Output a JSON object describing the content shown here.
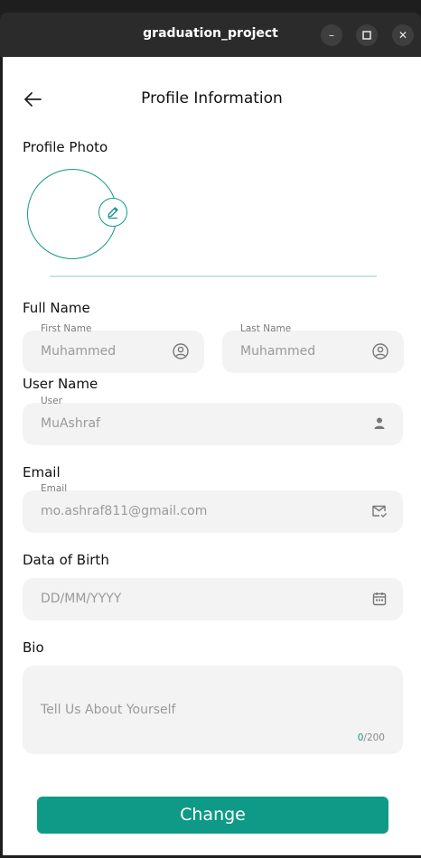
{
  "window": {
    "title": "graduation_project"
  },
  "header": {
    "title": "Profile Information"
  },
  "profile_photo": {
    "label": "Profile Photo"
  },
  "full_name": {
    "label": "Full Name",
    "first": {
      "label": "First Name",
      "placeholder": "Muhammed"
    },
    "last": {
      "label": "Last Name",
      "placeholder": "Muhammed"
    }
  },
  "user_name": {
    "label": "User Name",
    "field_label": "User",
    "placeholder": "MuAshraf"
  },
  "email": {
    "label": "Email",
    "field_label": "Email",
    "placeholder": "mo.ashraf811@gmail.com"
  },
  "dob": {
    "label": "Data of Birth",
    "placeholder": "DD/MM/YYYY"
  },
  "bio": {
    "label": "Bio",
    "placeholder": "Tell Us About Yourself",
    "count": "0",
    "max": "/200"
  },
  "submit": {
    "label": "Change"
  },
  "colors": {
    "accent": "#0e9a86",
    "field_bg": "#f3f3f3"
  }
}
